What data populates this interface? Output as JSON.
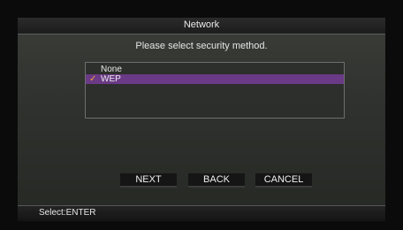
{
  "header": {
    "title": "Network"
  },
  "prompt": "Please select security method.",
  "security": {
    "options": [
      {
        "label": "None",
        "selected": false
      },
      {
        "label": "WEP",
        "selected": true
      }
    ],
    "check_glyph": "✓"
  },
  "buttons": {
    "next": "NEXT",
    "back": "BACK",
    "cancel": "CANCEL"
  },
  "footer": {
    "hint": "Select:ENTER"
  },
  "colors": {
    "selection": "#6a3a86",
    "check": "#f0a23a"
  }
}
